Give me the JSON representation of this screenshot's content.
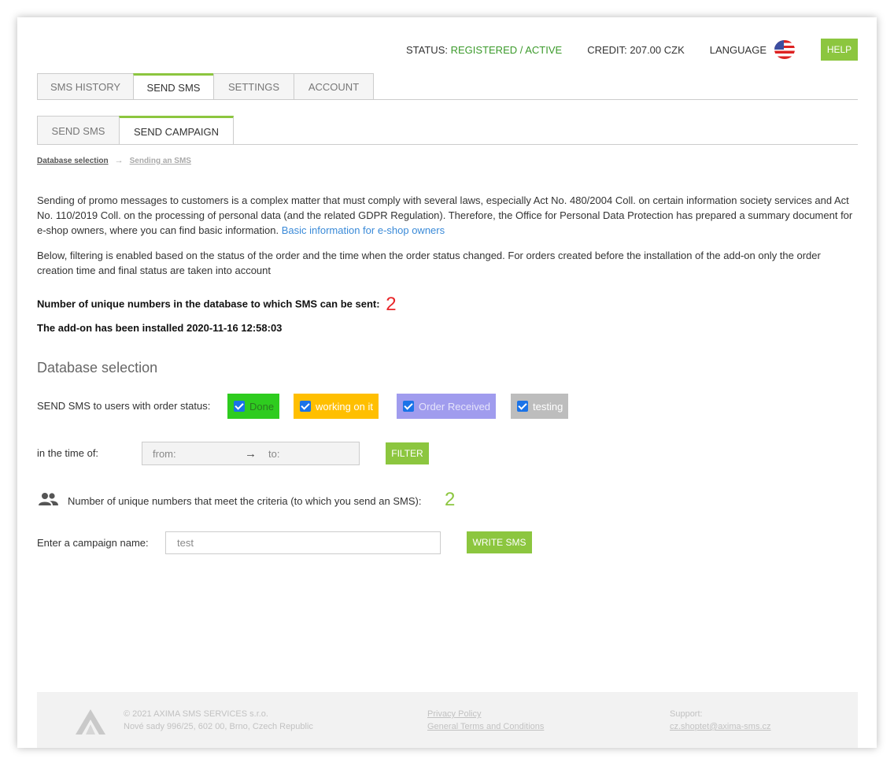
{
  "status_bar": {
    "status_label": "STATUS:",
    "status_value": "REGISTERED / ACTIVE",
    "credit": "CREDIT: 207.00 CZK",
    "language_label": "LANGUAGE",
    "help_label": "HELP"
  },
  "main_tabs": [
    "SMS HISTORY",
    "SEND SMS",
    "SETTINGS",
    "ACCOUNT"
  ],
  "sub_tabs": [
    "SEND SMS",
    "SEND CAMPAIGN"
  ],
  "breadcrumb": {
    "step1": "Database selection",
    "step2": "Sending an SMS"
  },
  "intro": {
    "text": "Sending of promo messages to customers is a complex matter that must comply with several laws, especially Act No. 480/2004 Coll. on certain information society services and Act No. 110/2019 Coll. on the processing of personal data (and the related GDPR Regulation). Therefore, the Office for Personal Data Protection has prepared a summary document for e-shop owners, where you can find basic information.",
    "link": "Basic information for e-shop owners",
    "filter_note": "Below, filtering is enabled based on the status of the order and the time when the order status changed. For orders created before the installation of the add-on only the order creation time and final status are taken into account"
  },
  "unique_numbers": {
    "label": "Number of unique numbers in the database to which SMS can be sent:",
    "value": "2"
  },
  "installed": "The add-on has been installed 2020-11-16 12:58:03",
  "section_title": "Database selection",
  "order_status": {
    "label": "SEND SMS to users with order status:",
    "chips": [
      {
        "label": "Done",
        "checked": true,
        "bg": "#2ecc1f",
        "color": "#2a7a20"
      },
      {
        "label": "working on it",
        "checked": true,
        "bg": "#ffbf00",
        "color": "#ffffff"
      },
      {
        "label": "Order Received",
        "checked": true,
        "bg": "#a09cee",
        "color": "#e6e4fb"
      },
      {
        "label": "testing",
        "checked": true,
        "bg": "#bdbdbd",
        "color": "#ffffff"
      }
    ]
  },
  "time_filter": {
    "label": "in the time of:",
    "from_placeholder": "from:",
    "arrow": "→",
    "to_placeholder": "to:",
    "button": "FILTER"
  },
  "criteria": {
    "icon": "users-icon",
    "label": "Number of unique numbers that meet the criteria (to which you send an SMS):",
    "value": "2"
  },
  "campaign": {
    "label": "Enter a campaign name:",
    "value": "test",
    "button": "WRITE SMS"
  },
  "footer": {
    "copyright": "© 2021 AXIMA SMS SERVICES s.r.o.",
    "address": "Nové sady 996/25, 602 00, Brno, Czech Republic",
    "privacy": "Privacy Policy",
    "terms": "General Terms and Conditions",
    "support_label": "Support:",
    "support_email": "cz.shoptet@axima-sms.cz"
  },
  "colors": {
    "accent": "#8cc63f",
    "active_status": "#3b9a2b",
    "count_red": "#e8262a",
    "count_green": "#8cc63f",
    "link": "#3a8ad8"
  }
}
